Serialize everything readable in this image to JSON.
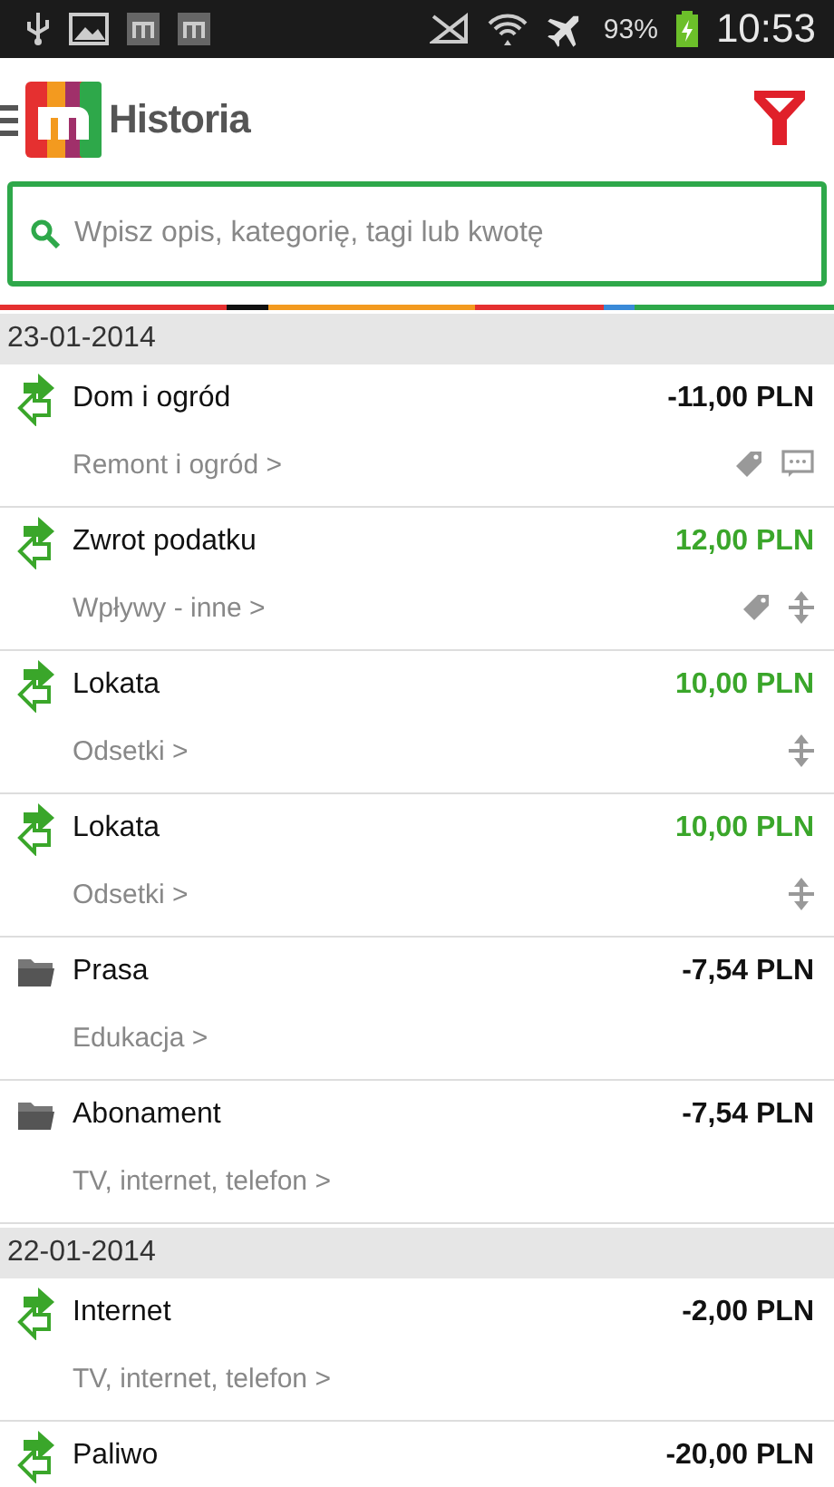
{
  "status_bar": {
    "battery": "93%",
    "time": "10:53"
  },
  "header": {
    "title": "Historia"
  },
  "search": {
    "placeholder": "Wpisz opis, kategorię, tagi lub kwotę"
  },
  "groups": [
    {
      "date": "23-01-2014",
      "items": [
        {
          "kind": "transfer",
          "title": "Dom i ogród",
          "amount": "-11,00 PLN",
          "income": false,
          "category": "Remont i ogród >",
          "tagged": true,
          "comment": true,
          "split": false
        },
        {
          "kind": "transfer",
          "title": "Zwrot podatku",
          "amount": "12,00 PLN",
          "income": true,
          "category": "Wpływy - inne >",
          "tagged": true,
          "comment": false,
          "split": true
        },
        {
          "kind": "transfer",
          "title": "Lokata",
          "amount": "10,00 PLN",
          "income": true,
          "category": "Odsetki >",
          "tagged": false,
          "comment": false,
          "split": true
        },
        {
          "kind": "transfer",
          "title": "Lokata",
          "amount": "10,00 PLN",
          "income": true,
          "category": "Odsetki >",
          "tagged": false,
          "comment": false,
          "split": true
        },
        {
          "kind": "folder",
          "title": "Prasa",
          "amount": "-7,54 PLN",
          "income": false,
          "category": "Edukacja >",
          "tagged": false,
          "comment": false,
          "split": false
        },
        {
          "kind": "folder",
          "title": "Abonament",
          "amount": "-7,54 PLN",
          "income": false,
          "category": "TV, internet, telefon >",
          "tagged": false,
          "comment": false,
          "split": false
        }
      ]
    },
    {
      "date": "22-01-2014",
      "items": [
        {
          "kind": "transfer",
          "title": "Internet",
          "amount": "-2,00 PLN",
          "income": false,
          "category": "TV, internet, telefon >",
          "tagged": false,
          "comment": false,
          "split": false
        },
        {
          "kind": "transfer",
          "title": "Paliwo",
          "amount": "-20,00 PLN",
          "income": false,
          "tagged": false,
          "comment": false,
          "split": false
        }
      ]
    }
  ]
}
